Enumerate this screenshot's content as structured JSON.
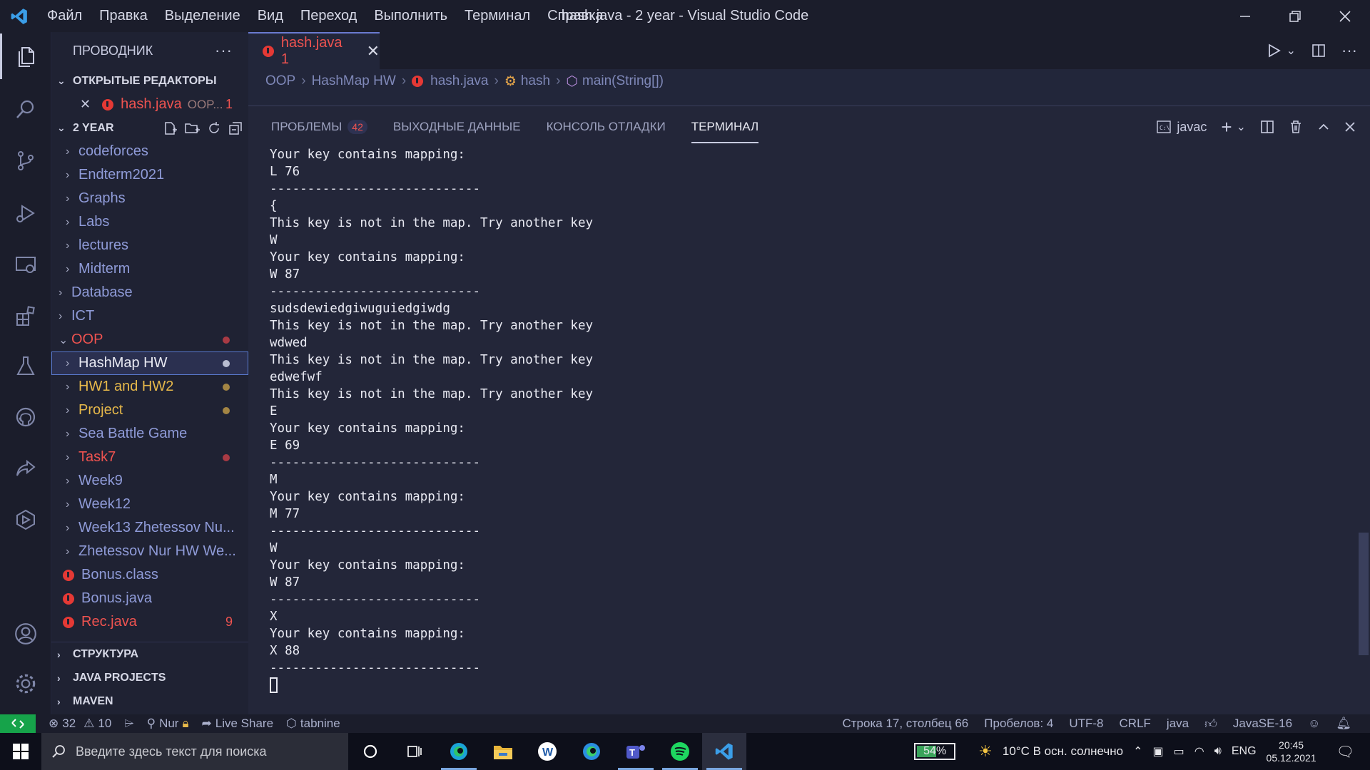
{
  "window": {
    "title": "hash.java - 2 year - Visual Studio Code",
    "menu": [
      "Файл",
      "Правка",
      "Выделение",
      "Вид",
      "Переход",
      "Выполнить",
      "Терминал",
      "Справка"
    ]
  },
  "sidebar": {
    "header": "ПРОВОДНИК",
    "open_editors": {
      "title": "ОТКРЫТЫЕ РЕДАКТОРЫ",
      "item_name": "hash.java",
      "item_path": "OOP...",
      "item_count": "1"
    },
    "workspace": {
      "title": "2 YEAR",
      "items": [
        {
          "label": "codeforces"
        },
        {
          "label": "Endterm2021"
        },
        {
          "label": "Graphs"
        },
        {
          "label": "Labs"
        },
        {
          "label": "lectures"
        },
        {
          "label": "Midterm"
        },
        {
          "label": "Database"
        },
        {
          "label": "ICT"
        },
        {
          "label": "OOP"
        },
        {
          "label": "HashMap HW"
        },
        {
          "label": "HW1 and HW2"
        },
        {
          "label": "Project"
        },
        {
          "label": "Sea Battle Game"
        },
        {
          "label": "Task7"
        },
        {
          "label": "Week9"
        },
        {
          "label": "Week12"
        },
        {
          "label": "Week13 Zhetessov Nu..."
        },
        {
          "label": "Zhetessov Nur HW We..."
        },
        {
          "label": "Bonus.class"
        },
        {
          "label": "Bonus.java"
        },
        {
          "label": "Rec.java",
          "count": "9"
        }
      ]
    },
    "sections": [
      "СТРУКТУРА",
      "JAVA PROJECTS",
      "MAVEN"
    ]
  },
  "editor": {
    "tab_label": "hash.java 1",
    "breadcrumb": [
      "OOP",
      "HashMap HW",
      "hash.java",
      "hash",
      "main(String[])"
    ]
  },
  "panel": {
    "tabs": [
      {
        "label": "ПРОБЛЕМЫ",
        "badge": "42"
      },
      {
        "label": "ВЫХОДНЫЕ ДАННЫЕ"
      },
      {
        "label": "КОНСОЛЬ ОТЛАДКИ"
      },
      {
        "label": "ТЕРМИНАЛ"
      }
    ],
    "terminal_name": "javac",
    "terminal_lines": [
      "Your key contains mapping:",
      "L 76",
      "----------------------------",
      "{",
      "This key is not in the map. Try another key",
      "W",
      "Your key contains mapping:",
      "W 87",
      "----------------------------",
      "sudsdewiedgiwuguiedgiwdg",
      "This key is not in the map. Try another key",
      "wdwed",
      "This key is not in the map. Try another key",
      "edwefwf",
      "This key is not in the map. Try another key",
      "E",
      "Your key contains mapping:",
      "E 69",
      "----------------------------",
      "M",
      "Your key contains mapping:",
      "M 77",
      "----------------------------",
      "W",
      "Your key contains mapping:",
      "W 87",
      "----------------------------",
      "X",
      "Your key contains mapping:",
      "X 88",
      "----------------------------"
    ]
  },
  "statusbar": {
    "errors": "32",
    "warnings": "10",
    "user": "Nur",
    "live_share": "Live Share",
    "tabnine": "tabnine",
    "position": "Строка 17, столбец 66",
    "spaces": "Пробелов: 4",
    "encoding": "UTF-8",
    "eol": "CRLF",
    "language": "java",
    "runtime": "JavaSE-16"
  },
  "taskbar": {
    "search_placeholder": "Введите здесь текст для поиска",
    "battery": "54%",
    "battery_level": 0.54,
    "weather": "10°C  В осн. солнечно",
    "lang": "ENG",
    "time": "20:45",
    "date": "05.12.2021"
  },
  "colors": {
    "accent": "#6a7ad0",
    "error": "#ef5350",
    "modified": "#e6b84a",
    "remote": "#16a34a"
  }
}
